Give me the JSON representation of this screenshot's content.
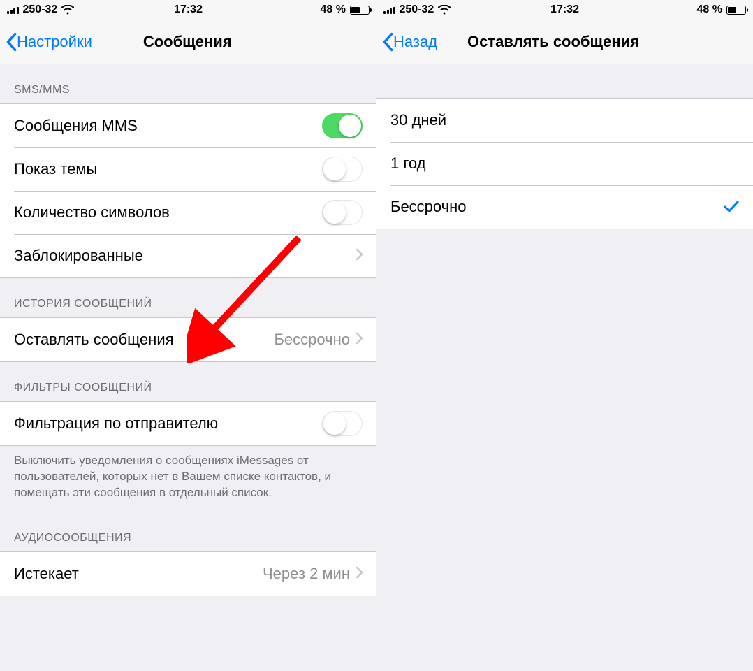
{
  "status": {
    "carrier": "250-32",
    "time": "17:32",
    "battery_text": "48 %"
  },
  "left_screen": {
    "nav": {
      "back": "Настройки",
      "title": "Сообщения"
    },
    "section1": {
      "header": "SMS/MMS",
      "rows": [
        {
          "label": "Сообщения MMS",
          "toggle": true
        },
        {
          "label": "Показ темы",
          "toggle": false
        },
        {
          "label": "Количество символов",
          "toggle": false
        },
        {
          "label": "Заблокированные"
        }
      ]
    },
    "section2": {
      "header": "ИСТОРИЯ СООБЩЕНИЙ",
      "rows": [
        {
          "label": "Оставлять сообщения",
          "detail": "Бессрочно"
        }
      ]
    },
    "section3": {
      "header": "ФИЛЬТРЫ СООБЩЕНИЙ",
      "rows": [
        {
          "label": "Фильтрация по отправителю",
          "toggle": false
        }
      ],
      "footer": "Выключить уведомления о сообщениях iMessages от пользователей, которых нет в Вашем списке контактов, и помещать эти сообщения в отдельный список."
    },
    "section4": {
      "header": "АУДИОСООБЩЕНИЯ",
      "rows": [
        {
          "label": "Истекает",
          "detail": "Через 2 мин"
        }
      ]
    }
  },
  "right_screen": {
    "nav": {
      "back": "Назад",
      "title": "Оставлять сообщения"
    },
    "options": [
      {
        "label": "30 дней",
        "selected": false
      },
      {
        "label": "1 год",
        "selected": false
      },
      {
        "label": "Бессрочно",
        "selected": true
      }
    ]
  }
}
